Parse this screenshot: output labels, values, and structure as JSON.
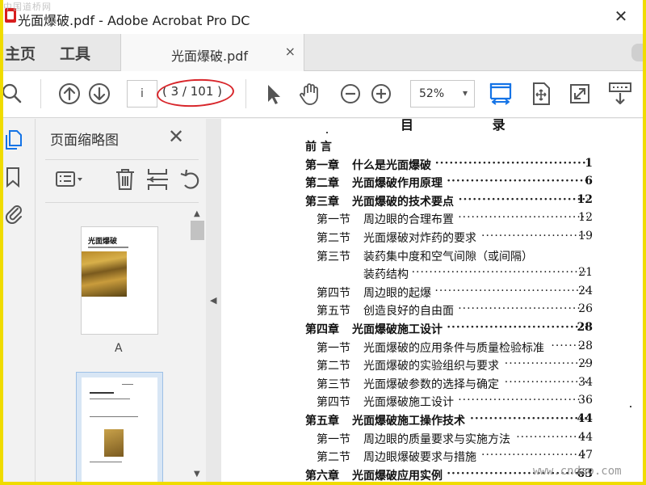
{
  "window": {
    "title": "光面爆破.pdf - Adobe Acrobat Pro DC",
    "watermark": "中国道桥网",
    "close_glyph": "✕"
  },
  "tabs": {
    "home": "主页",
    "tools": "工具",
    "document": "光面爆破.pdf",
    "close_glyph": "×"
  },
  "toolbar": {
    "page_input": "i",
    "page_count": "( 3 / 101 )",
    "zoom": "52%",
    "zoom_caret": "▾"
  },
  "panel": {
    "title": "页面缩略图",
    "close_glyph": "✕",
    "thumbnails": [
      {
        "page_title": "光面爆破",
        "label": "A"
      }
    ]
  },
  "document": {
    "heading": "目 录",
    "watermark": "www.cndao.com",
    "toc": [
      {
        "level": "chapter",
        "number": "前  言",
        "title": "",
        "page": ""
      },
      {
        "level": "chapter",
        "number": "第一章",
        "title": "什么是光面爆破",
        "page": "1"
      },
      {
        "level": "chapter",
        "number": "第二章",
        "title": "光面爆破作用原理",
        "page": "6"
      },
      {
        "level": "chapter",
        "number": "第三章",
        "title": "光面爆破的技术要点",
        "page": "12"
      },
      {
        "level": "section",
        "number": "第一节",
        "title": "周边眼的合理布置",
        "page": "12"
      },
      {
        "level": "section",
        "number": "第二节",
        "title": "光面爆破对炸药的要求",
        "page": "19"
      },
      {
        "level": "section",
        "number": "第三节",
        "title": "装药集中度和空气间隙（或间隔）",
        "page": ""
      },
      {
        "level": "continuation",
        "number": "",
        "title": "装药结构",
        "page": "21"
      },
      {
        "level": "section",
        "number": "第四节",
        "title": "周边眼的起爆",
        "page": "24"
      },
      {
        "level": "section",
        "number": "第五节",
        "title": "创造良好的自由面",
        "page": "26"
      },
      {
        "level": "chapter",
        "number": "第四章",
        "title": "光面爆破施工设计",
        "page": "28"
      },
      {
        "level": "section",
        "number": "第一节",
        "title": "光面爆破的应用条件与质量检验标准",
        "page": "28"
      },
      {
        "level": "section",
        "number": "第二节",
        "title": "光面爆破的实验组织与要求",
        "page": "29"
      },
      {
        "level": "section",
        "number": "第三节",
        "title": "光面爆破参数的选择与确定",
        "page": "34"
      },
      {
        "level": "section",
        "number": "第四节",
        "title": "光面爆破施工设计",
        "page": "36"
      },
      {
        "level": "chapter",
        "number": "第五章",
        "title": "光面爆破施工操作技术",
        "page": "44"
      },
      {
        "level": "section",
        "number": "第一节",
        "title": "周边眼的质量要求与实施方法",
        "page": "44"
      },
      {
        "level": "section",
        "number": "第二节",
        "title": "周边眼爆破要求与措施",
        "page": "47"
      },
      {
        "level": "chapter",
        "number": "第六章",
        "title": "光面爆破应用实例",
        "page": "63"
      }
    ]
  },
  "colors": {
    "accent": "#1473e6",
    "highlight_oval": "#d8262b",
    "frame": "#f0dc00"
  }
}
